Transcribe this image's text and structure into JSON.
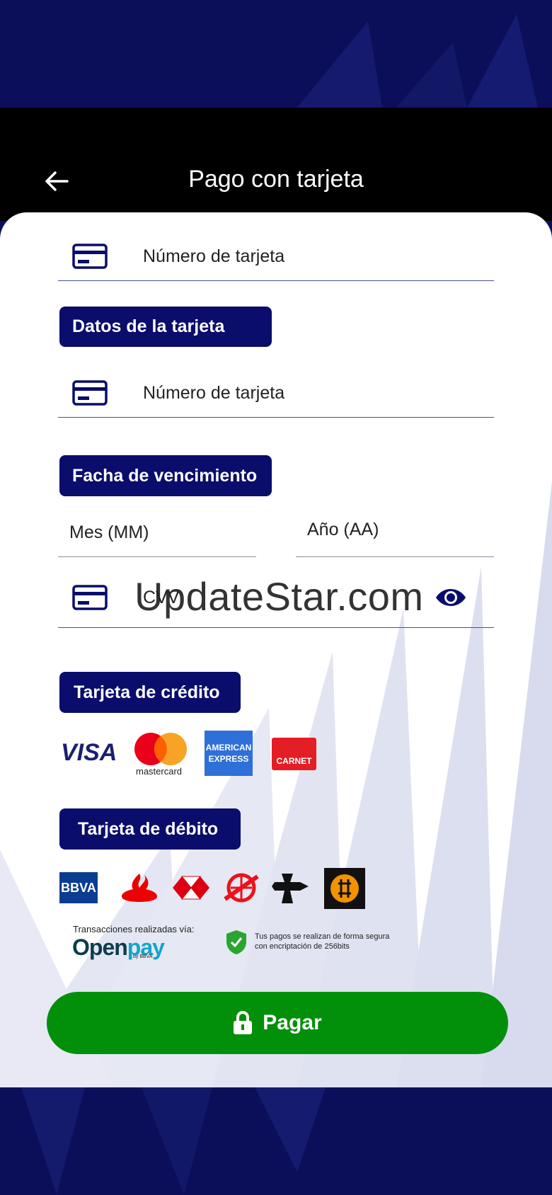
{
  "header": {
    "title": "Pago con tarjeta",
    "back_icon": "arrow-left-icon"
  },
  "form": {
    "card_number_top_label": "Número de tarjeta",
    "section_card_data": "Datos de la tarjeta",
    "card_number_label": "Número de tarjeta",
    "section_expiry": "Facha de vencimiento",
    "month_label": "Mes (MM)",
    "year_label": "Año (AA)",
    "cvv_label": "CVV"
  },
  "watermark": "UpdateStar.com",
  "credit": {
    "title": "Tarjeta de crédito",
    "logos": [
      "VISA",
      "mastercard",
      "AMERICAN",
      "EXPRESS",
      "CARNET"
    ]
  },
  "debit": {
    "title": "Tarjeta de débito",
    "logos": [
      "BBVA"
    ]
  },
  "security": {
    "openpay_caption": "Transacciones realizadas vía:",
    "openpay_logo_open": "Open",
    "openpay_logo_pay": "pay",
    "openpay_by": "by BBVA",
    "secure_line1": "Tus pagos se realizan de forma segura",
    "secure_line2": "con encriptación de 256bits"
  },
  "pay_button": {
    "label": "Pagar",
    "icon": "lock-icon"
  },
  "colors": {
    "navy": "#0a0d6b",
    "green": "#02900a",
    "header": "#000000"
  }
}
